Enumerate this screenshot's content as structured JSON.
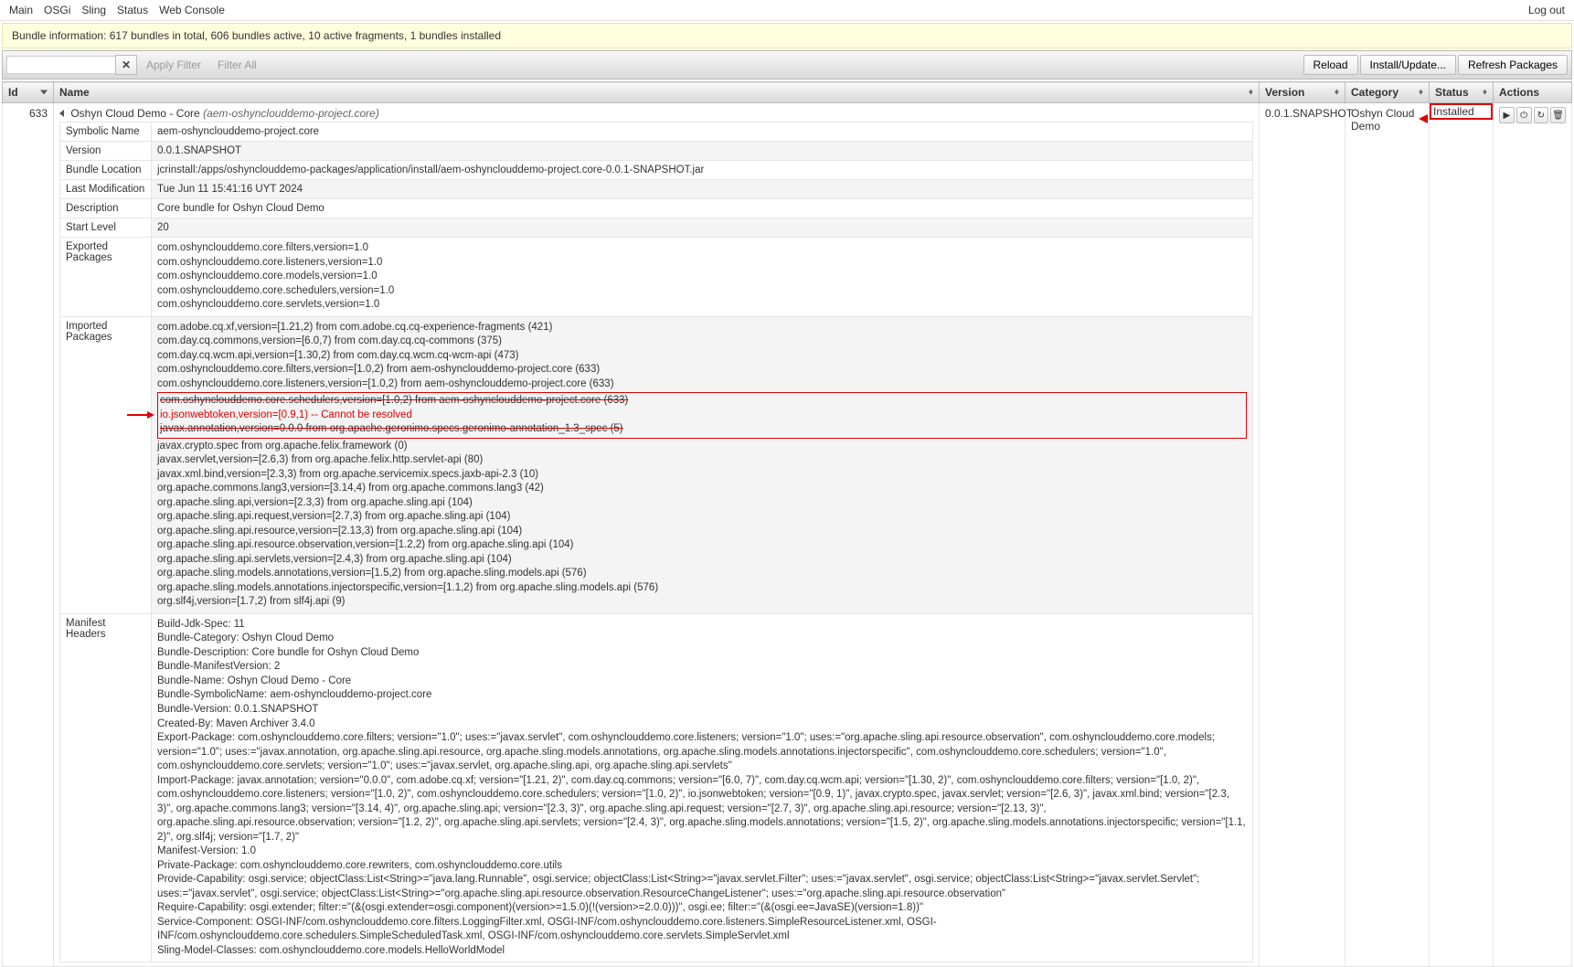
{
  "nav": {
    "main": "Main",
    "osgi": "OSGi",
    "sling": "Sling",
    "status": "Status",
    "web": "Web Console",
    "logout": "Log out"
  },
  "info": "Bundle information: 617 bundles in total, 606 bundles active, 10 active fragments, 1 bundles installed",
  "toolbar": {
    "apply": "Apply Filter",
    "all": "Filter All",
    "reload": "Reload",
    "install": "Install/Update...",
    "refresh": "Refresh Packages"
  },
  "cols": {
    "id": "Id",
    "name": "Name",
    "version": "Version",
    "category": "Category",
    "status": "Status",
    "actions": "Actions"
  },
  "row": {
    "id": "633",
    "name": "Oshyn Cloud Demo - Core",
    "name_sym": "(aem-oshynclouddemo-project.core)",
    "version": "0.0.1.SNAPSHOT",
    "category": "Oshyn Cloud Demo",
    "status": "Installed"
  },
  "details": {
    "symbolic_name": {
      "label": "Symbolic Name",
      "value": "aem-oshynclouddemo-project.core"
    },
    "version": {
      "label": "Version",
      "value": "0.0.1.SNAPSHOT"
    },
    "location": {
      "label": "Bundle Location",
      "value": "jcrinstall:/apps/oshynclouddemo-packages/application/install/aem-oshynclouddemo-project.core-0.0.1-SNAPSHOT.jar"
    },
    "last_mod": {
      "label": "Last Modification",
      "value": "Tue Jun 11 15:41:16 UYT 2024"
    },
    "description": {
      "label": "Description",
      "value": "Core bundle for Oshyn Cloud Demo"
    },
    "start_level": {
      "label": "Start Level",
      "value": "20"
    },
    "exported": {
      "label": "Exported Packages",
      "lines": [
        "com.oshynclouddemo.core.filters,version=1.0",
        "com.oshynclouddemo.core.listeners,version=1.0",
        "com.oshynclouddemo.core.models,version=1.0",
        "com.oshynclouddemo.core.schedulers,version=1.0",
        "com.oshynclouddemo.core.servlets,version=1.0"
      ]
    },
    "imported": {
      "label": "Imported Packages",
      "before": [
        "com.adobe.cq.xf,version=[1.21,2) from com.adobe.cq.cq-experience-fragments (421)",
        "com.day.cq.commons,version=[6.0,7) from com.day.cq.cq-commons (375)",
        "com.day.cq.wcm.api,version=[1.30,2) from com.day.cq.wcm.cq-wcm-api (473)",
        "com.oshynclouddemo.core.filters,version=[1.0,2) from aem-oshynclouddemo-project.core (633)",
        "com.oshynclouddemo.core.listeners,version=[1.0,2) from aem-oshynclouddemo-project.core (633)"
      ],
      "highlight_top": "com.oshynclouddemo.core.schedulers,version=[1.0,2) from aem-oshynclouddemo-project.core (633)",
      "highlight_err": "io.jsonwebtoken,version=[0.9,1) -- Cannot be resolved",
      "highlight_bot": "javax.annotation,version=0.0.0 from org.apache.geronimo.specs.geronimo-annotation_1.3_spec (5)",
      "after": [
        "javax.crypto.spec from org.apache.felix.framework (0)",
        "javax.servlet,version=[2.6,3) from org.apache.felix.http.servlet-api (80)",
        "javax.xml.bind,version=[2.3,3) from org.apache.servicemix.specs.jaxb-api-2.3 (10)",
        "org.apache.commons.lang3,version=[3.14,4) from org.apache.commons.lang3 (42)",
        "org.apache.sling.api,version=[2.3,3) from org.apache.sling.api (104)",
        "org.apache.sling.api.request,version=[2.7,3) from org.apache.sling.api (104)",
        "org.apache.sling.api.resource,version=[2.13,3) from org.apache.sling.api (104)",
        "org.apache.sling.api.resource.observation,version=[1.2,2) from org.apache.sling.api (104)",
        "org.apache.sling.api.servlets,version=[2.4,3) from org.apache.sling.api (104)",
        "org.apache.sling.models.annotations,version=[1.5,2) from org.apache.sling.models.api (576)",
        "org.apache.sling.models.annotations.injectorspecific,version=[1.1,2) from org.apache.sling.models.api (576)",
        "org.slf4j,version=[1.7,2) from slf4j.api (9)"
      ]
    },
    "manifest": {
      "label": "Manifest Headers",
      "lines": [
        "Build-Jdk-Spec: 11",
        "Bundle-Category: Oshyn Cloud Demo",
        "Bundle-Description: Core bundle for Oshyn Cloud Demo",
        "Bundle-ManifestVersion: 2",
        "Bundle-Name: Oshyn Cloud Demo - Core",
        "Bundle-SymbolicName: aem-oshynclouddemo-project.core",
        "Bundle-Version: 0.0.1.SNAPSHOT",
        "Created-By: Maven Archiver 3.4.0",
        "Export-Package: com.oshynclouddemo.core.filters; version=\"1.0\"; uses:=\"javax.servlet\", com.oshynclouddemo.core.listeners; version=\"1.0\"; uses:=\"org.apache.sling.api.resource.observation\", com.oshynclouddemo.core.models; version=\"1.0\"; uses:=\"javax.annotation, org.apache.sling.api.resource, org.apache.sling.models.annotations, org.apache.sling.models.annotations.injectorspecific\", com.oshynclouddemo.core.schedulers; version=\"1.0\", com.oshynclouddemo.core.servlets; version=\"1.0\"; uses:=\"javax.servlet, org.apache.sling.api, org.apache.sling.api.servlets\"",
        "Import-Package: javax.annotation; version=\"0.0.0\", com.adobe.cq.xf; version=\"[1.21, 2)\", com.day.cq.commons; version=\"[6.0, 7)\", com.day.cq.wcm.api; version=\"[1.30, 2)\", com.oshynclouddemo.core.filters; version=\"[1.0, 2)\", com.oshynclouddemo.core.listeners; version=\"[1.0, 2)\", com.oshynclouddemo.core.schedulers; version=\"[1.0, 2)\", io.jsonwebtoken; version=\"[0.9, 1)\", javax.crypto.spec, javax.servlet; version=\"[2.6, 3)\", javax.xml.bind; version=\"[2.3, 3)\", org.apache.commons.lang3; version=\"[3.14, 4)\", org.apache.sling.api; version=\"[2.3, 3)\", org.apache.sling.api.request; version=\"[2.7, 3)\", org.apache.sling.api.resource; version=\"[2.13, 3)\", org.apache.sling.api.resource.observation; version=\"[1.2, 2)\", org.apache.sling.api.servlets; version=\"[2.4, 3)\", org.apache.sling.models.annotations; version=\"[1.5, 2)\", org.apache.sling.models.annotations.injectorspecific; version=\"[1.1, 2)\", org.slf4j; version=\"[1.7, 2)\"",
        "Manifest-Version: 1.0",
        "Private-Package: com.oshynclouddemo.core.rewriters, com.oshynclouddemo.core.utils",
        "Provide-Capability: osgi.service; objectClass:List<String>=\"java.lang.Runnable\", osgi.service; objectClass:List<String>=\"javax.servlet.Filter\"; uses:=\"javax.servlet\", osgi.service; objectClass:List<String>=\"javax.servlet.Servlet\"; uses:=\"javax.servlet\", osgi.service; objectClass:List<String>=\"org.apache.sling.api.resource.observation.ResourceChangeListener\"; uses:=\"org.apache.sling.api.resource.observation\"",
        "Require-Capability: osgi.extender; filter:=\"(&(osgi.extender=osgi.component)(version>=1.5.0)(!(version>=2.0.0)))\", osgi.ee; filter:=\"(&(osgi.ee=JavaSE)(version=1.8))\"",
        "Service-Component: OSGI-INF/com.oshynclouddemo.core.filters.LoggingFilter.xml, OSGI-INF/com.oshynclouddemo.core.listeners.SimpleResourceListener.xml, OSGI-INF/com.oshynclouddemo.core.schedulers.SimpleScheduledTask.xml, OSGI-INF/com.oshynclouddemo.core.servlets.SimpleServlet.xml",
        "Sling-Model-Classes: com.oshynclouddemo.core.models.HelloWorldModel"
      ]
    }
  }
}
